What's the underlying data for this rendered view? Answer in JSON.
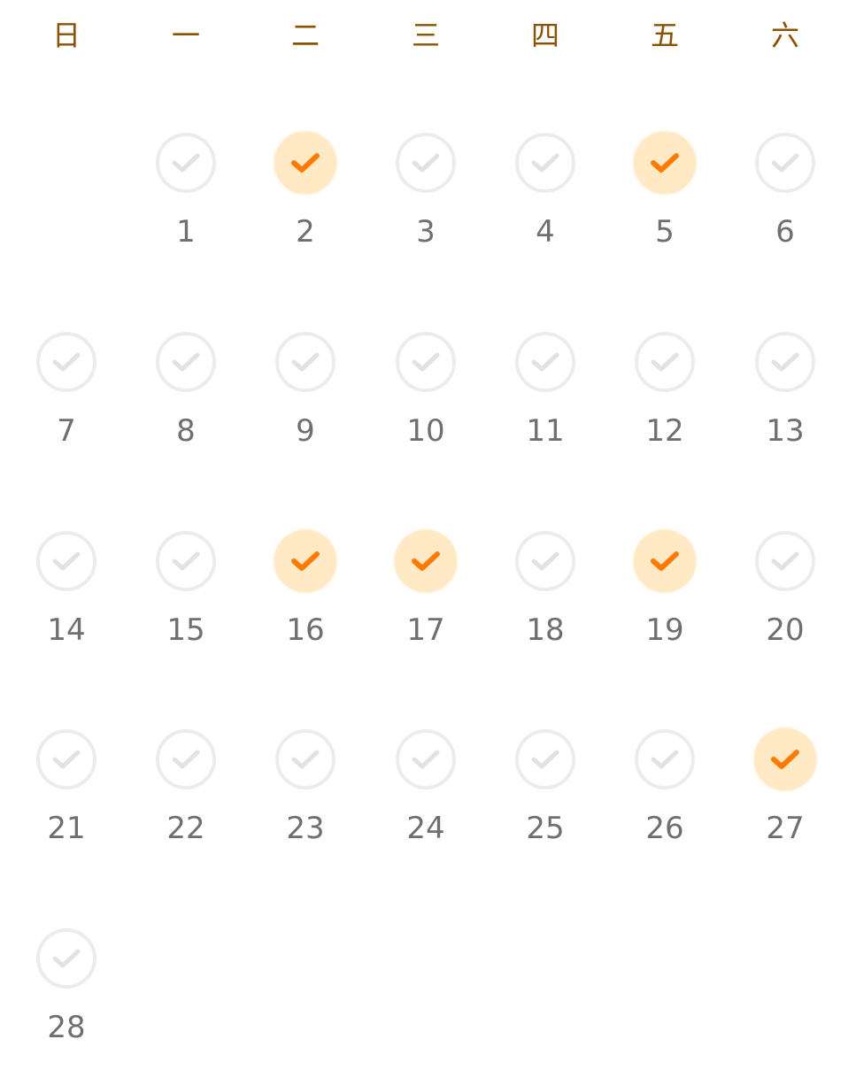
{
  "calendar": {
    "weekdays": [
      "日",
      "一",
      "二",
      "三",
      "四",
      "五",
      "六"
    ],
    "first_weekday_index": 1,
    "days": [
      {
        "day": "1",
        "checked": false
      },
      {
        "day": "2",
        "checked": true
      },
      {
        "day": "3",
        "checked": false
      },
      {
        "day": "4",
        "checked": false
      },
      {
        "day": "5",
        "checked": true
      },
      {
        "day": "6",
        "checked": false
      },
      {
        "day": "7",
        "checked": false
      },
      {
        "day": "8",
        "checked": false
      },
      {
        "day": "9",
        "checked": false
      },
      {
        "day": "10",
        "checked": false
      },
      {
        "day": "11",
        "checked": false
      },
      {
        "day": "12",
        "checked": false
      },
      {
        "day": "13",
        "checked": false
      },
      {
        "day": "14",
        "checked": false
      },
      {
        "day": "15",
        "checked": false
      },
      {
        "day": "16",
        "checked": true
      },
      {
        "day": "17",
        "checked": true
      },
      {
        "day": "18",
        "checked": false
      },
      {
        "day": "19",
        "checked": true
      },
      {
        "day": "20",
        "checked": false
      },
      {
        "day": "21",
        "checked": false
      },
      {
        "day": "22",
        "checked": false
      },
      {
        "day": "23",
        "checked": false
      },
      {
        "day": "24",
        "checked": false
      },
      {
        "day": "25",
        "checked": false
      },
      {
        "day": "26",
        "checked": false
      },
      {
        "day": "27",
        "checked": true
      },
      {
        "day": "28",
        "checked": false
      }
    ]
  },
  "colors": {
    "weekday_text": "#8a5200",
    "day_text": "#6f6f6f",
    "check_on_fill": "#ffeac5",
    "check_on_mark": "#ff7a00",
    "check_off_ring": "#ececec",
    "check_off_mark": "#e2e2e2"
  },
  "icons": {
    "checked": "checkmark-filled-icon",
    "unchecked": "checkmark-outline-icon"
  }
}
